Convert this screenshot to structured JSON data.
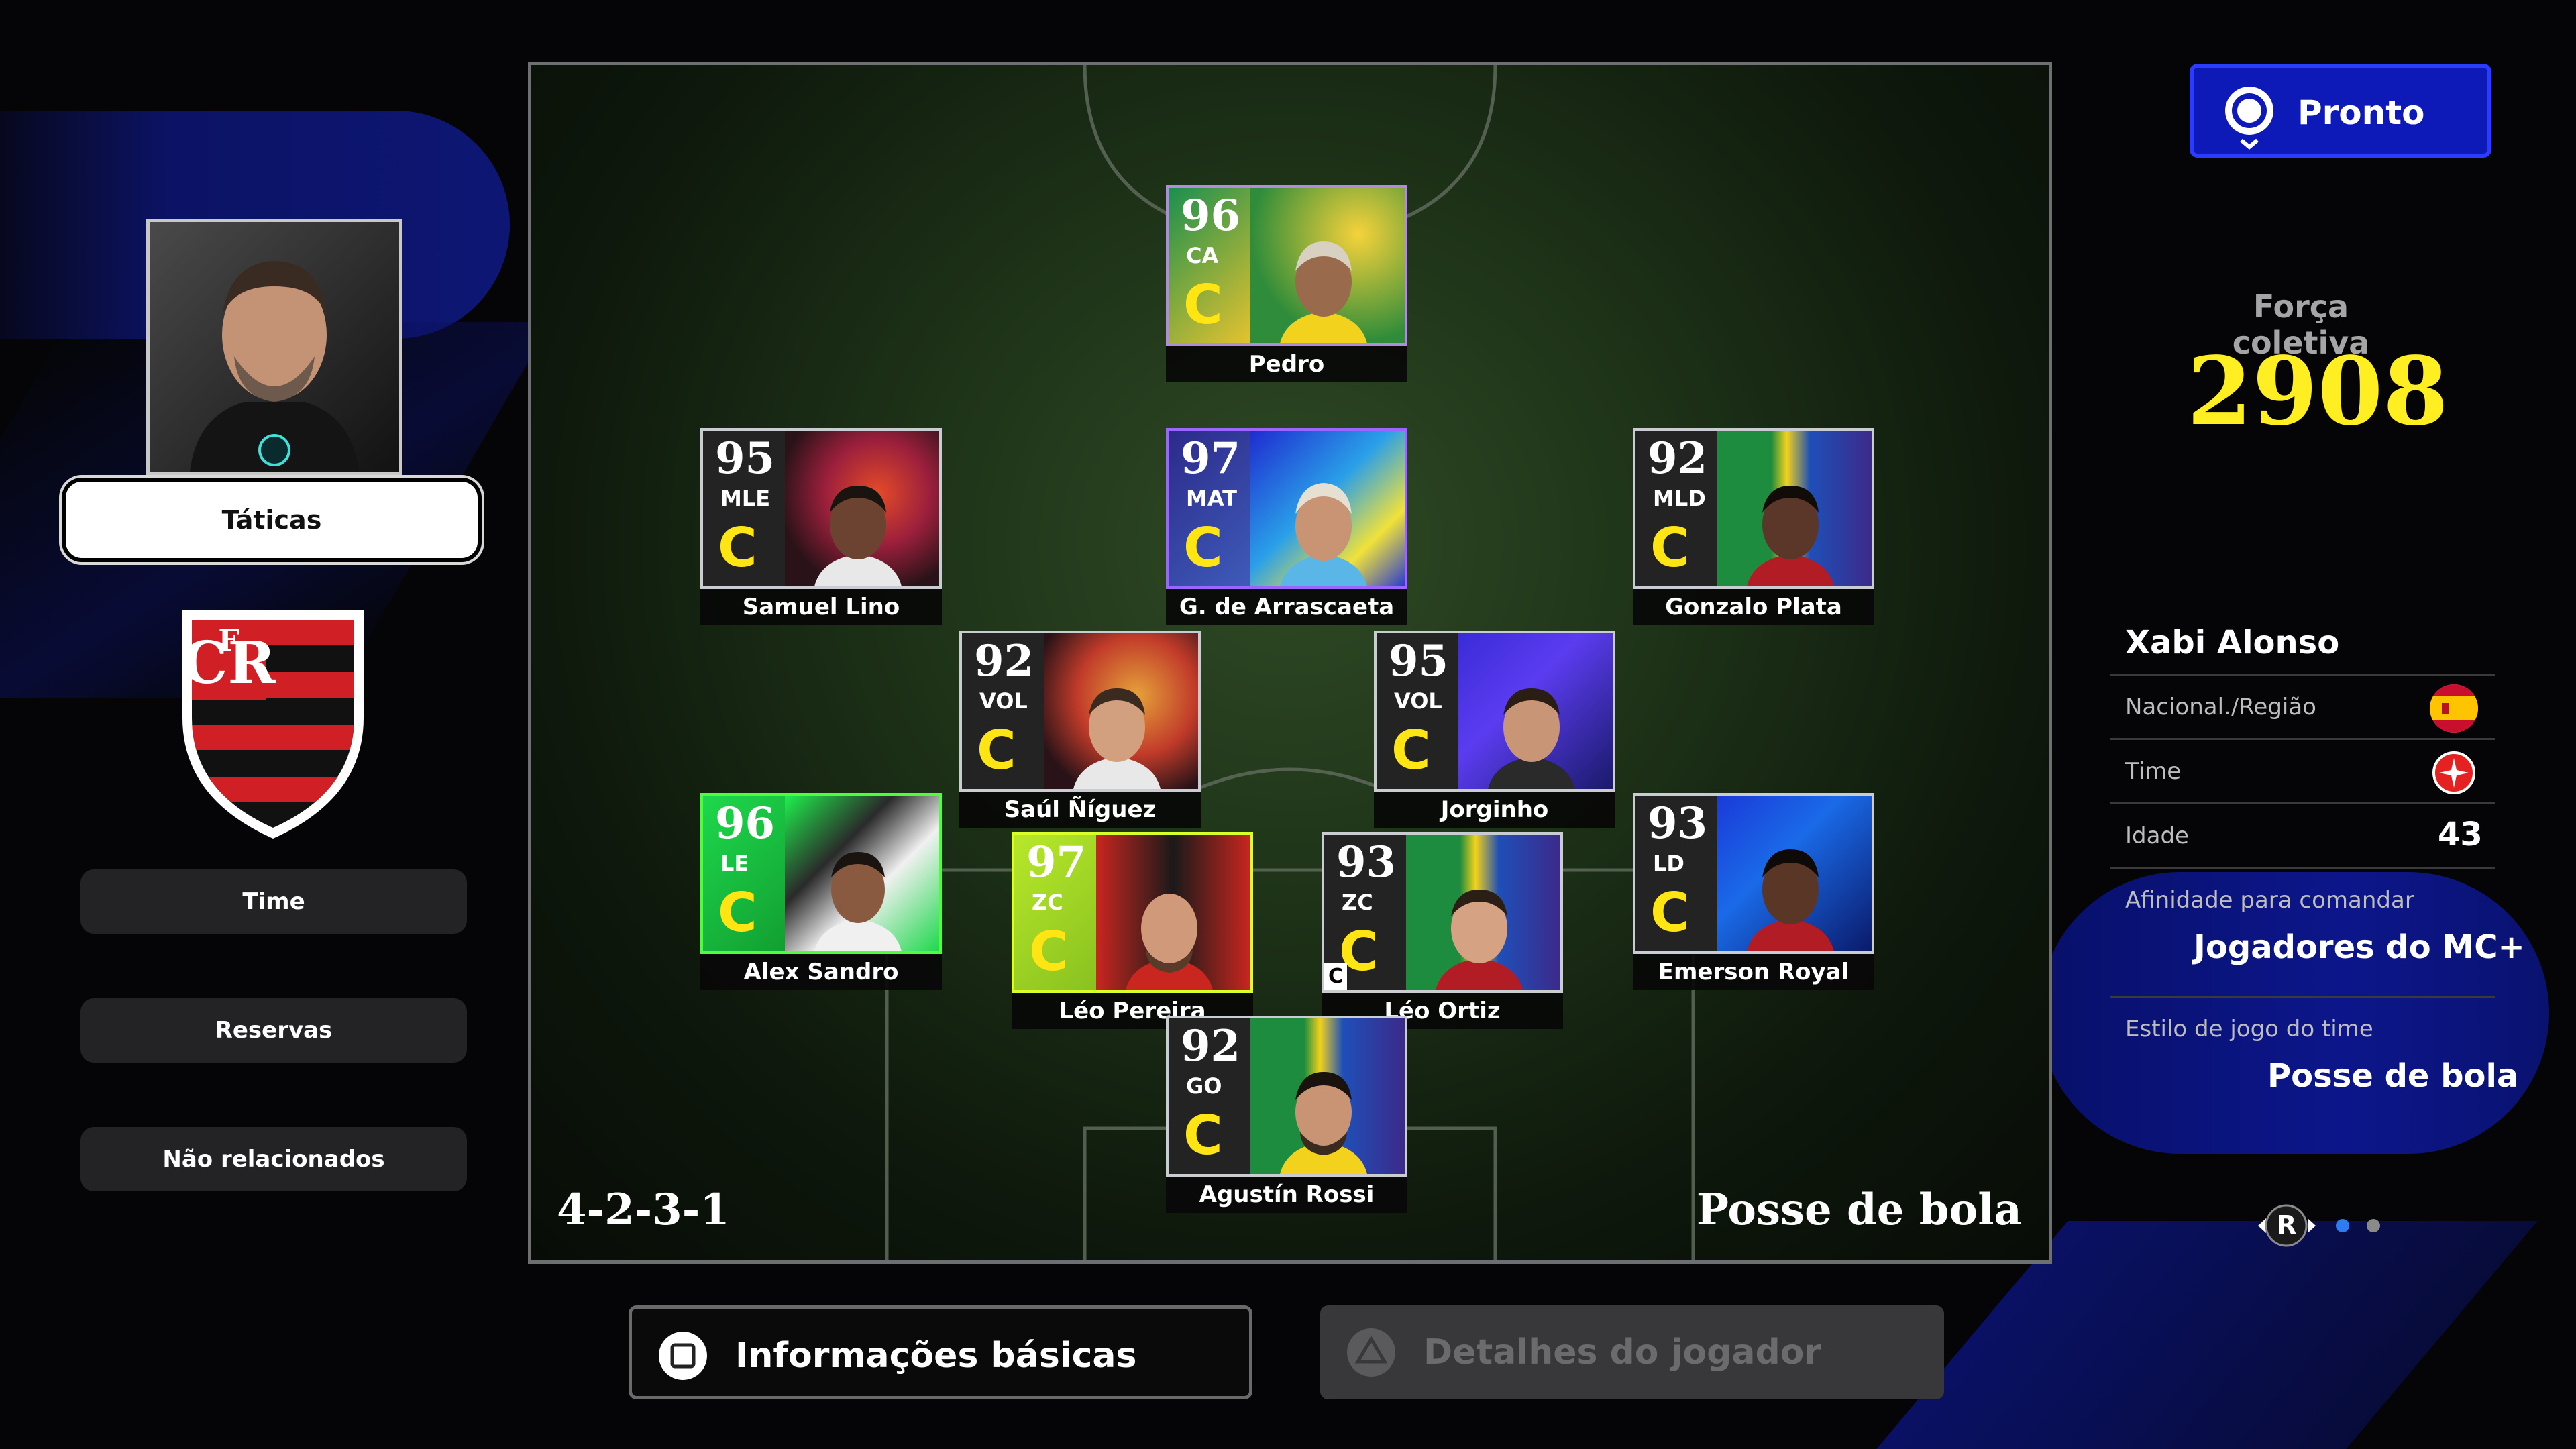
{
  "ready_button": {
    "label": "Pronto"
  },
  "collective_strength": {
    "label": "Força coletiva",
    "value": "2908"
  },
  "left_menu": {
    "tactics": "Táticas",
    "team": "Time",
    "reserves": "Reservas",
    "not_listed": "Não relacionados"
  },
  "pitch": {
    "formation": "4-2-3-1",
    "style": "Posse de bola"
  },
  "players": [
    {
      "name": "Pedro",
      "rating": "96",
      "position": "CA",
      "condition": "C"
    },
    {
      "name": "Samuel Lino",
      "rating": "95",
      "position": "MLE",
      "condition": "C"
    },
    {
      "name": "G. de Arrascaeta",
      "rating": "97",
      "position": "MAT",
      "condition": "C"
    },
    {
      "name": "Gonzalo Plata",
      "rating": "92",
      "position": "MLD",
      "condition": "C"
    },
    {
      "name": "Saúl Ñíguez",
      "rating": "92",
      "position": "VOL",
      "condition": "C"
    },
    {
      "name": "Jorginho",
      "rating": "95",
      "position": "VOL",
      "condition": "C"
    },
    {
      "name": "Alex Sandro",
      "rating": "96",
      "position": "LE",
      "condition": "C"
    },
    {
      "name": "Léo Pereira",
      "rating": "97",
      "position": "ZC",
      "condition": "C"
    },
    {
      "name": "Léo Ortiz",
      "rating": "93",
      "position": "ZC",
      "condition": "C",
      "captain": "C"
    },
    {
      "name": "Emerson Royal",
      "rating": "93",
      "position": "LD",
      "condition": "C"
    },
    {
      "name": "Agustín Rossi",
      "rating": "92",
      "position": "GO",
      "condition": "C"
    }
  ],
  "coach": {
    "name": "Xabi Alonso",
    "nationality_label": "Nacional./Região",
    "team_label": "Time",
    "age_label": "Idade",
    "age": "43",
    "affinity_label": "Afinidade para comandar",
    "affinity": "Jogadores do MC+",
    "team_style_label": "Estilo de jogo do time",
    "team_style": "Posse de bola"
  },
  "pager": {
    "button": "R"
  },
  "bottom": {
    "info": "Informações básicas",
    "details": "Detalhes do jogador"
  },
  "colors": {
    "accent_blue": "#0e1ab8",
    "strength_yellow": "#ffee22",
    "condition_yellow": "#ffe514"
  }
}
